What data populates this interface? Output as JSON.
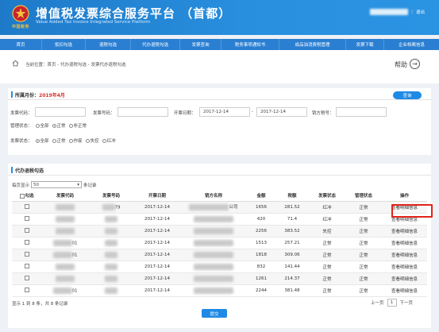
{
  "header": {
    "title": "增值税发票综合服务平台 （首都）",
    "subtitle": "Value Added Tax Invoice Integrated Service Platform",
    "emblem_text": "中国税务",
    "logout": "退出"
  },
  "nav": [
    "首页",
    "抵扣勾选",
    "退税勾选",
    "代办退税勾选",
    "发票查询",
    "税务事项通知书",
    "成品油消费税管理",
    "发票下载",
    "企业档案信息"
  ],
  "breadcrumb": {
    "text": "当前位置：首页 - 代办退税勾选 - 发票代办退税勾选"
  },
  "help": {
    "label": "帮助"
  },
  "filter": {
    "period_label": "所属月份：",
    "period_value": "2019年4月",
    "query_button": "查询",
    "invoice_code_label": "发票代码：",
    "invoice_no_label": "发票号码：",
    "issue_date_label": "开票日期：",
    "date_from": "2017-12-14",
    "date_to": "2017-12-14",
    "date_sep": "-",
    "seller_tax_label": "销方税号：",
    "manage_status_label": "管理状态：",
    "manage_status_options": [
      "全部",
      "正常",
      "非正常"
    ],
    "invoice_status_label": "发票状态：",
    "invoice_status_options": [
      "全部",
      "正常",
      "作废",
      "失控",
      "红冲"
    ]
  },
  "table_panel": {
    "title": "代办退税勾选",
    "page_size_prefix": "每页显示",
    "page_size_value": "50",
    "page_size_suffix": "条记录",
    "columns": [
      "勾选",
      "发票代码",
      "发票号码",
      "开票日期",
      "销方名称",
      "金额",
      "税额",
      "发票状态",
      "管理状态",
      "操作"
    ],
    "rows": [
      {
        "code_tail": "",
        "number_tail": "79",
        "date": "2017-12-14",
        "seller_tail": "公司",
        "amount": "1656",
        "tax": "281.52",
        "invoice_status": "红冲",
        "manage_status": "正常",
        "action": "查看明细信息"
      },
      {
        "code_tail": "",
        "number_tail": "",
        "date": "2017-12-14",
        "seller_tail": "",
        "amount": "420",
        "tax": "71.4",
        "invoice_status": "红冲",
        "manage_status": "正常",
        "action": "查看明细信息"
      },
      {
        "code_tail": "",
        "number_tail": "",
        "date": "2017-12-14",
        "seller_tail": "",
        "amount": "2256",
        "tax": "383.52",
        "invoice_status": "失控",
        "manage_status": "正常",
        "action": "查看明细信息"
      },
      {
        "code_tail": "01",
        "number_tail": "",
        "date": "2017-12-14",
        "seller_tail": "",
        "amount": "1513",
        "tax": "257.21",
        "invoice_status": "正常",
        "manage_status": "正常",
        "action": "查看明细信息"
      },
      {
        "code_tail": "01",
        "number_tail": "",
        "date": "2017-12-14",
        "seller_tail": "",
        "amount": "1818",
        "tax": "309.06",
        "invoice_status": "正常",
        "manage_status": "正常",
        "action": "查看明细信息"
      },
      {
        "code_tail": "",
        "number_tail": "",
        "date": "2017-12-14",
        "seller_tail": "",
        "amount": "832",
        "tax": "141.44",
        "invoice_status": "正常",
        "manage_status": "正常",
        "action": "查看明细信息"
      },
      {
        "code_tail": "",
        "number_tail": "",
        "date": "2017-12-14",
        "seller_tail": "",
        "amount": "1261",
        "tax": "214.37",
        "invoice_status": "正常",
        "manage_status": "正常",
        "action": "查看明细信息"
      },
      {
        "code_tail": "01",
        "number_tail": "",
        "date": "2017-12-14",
        "seller_tail": "",
        "amount": "2244",
        "tax": "381.48",
        "invoice_status": "正常",
        "manage_status": "正常",
        "action": "查看明细信息"
      }
    ],
    "summary": "显示 1 到 8 条，共 8 条记录",
    "pager": {
      "prev": "上一页",
      "current": "1",
      "next": "下一页"
    },
    "submit_button": "提交"
  },
  "colors": {
    "header_blue": "#2a8be0",
    "nav_blue": "#2a7fd2",
    "accent_red": "#e0241b",
    "button_blue": "#1f8ae6"
  }
}
